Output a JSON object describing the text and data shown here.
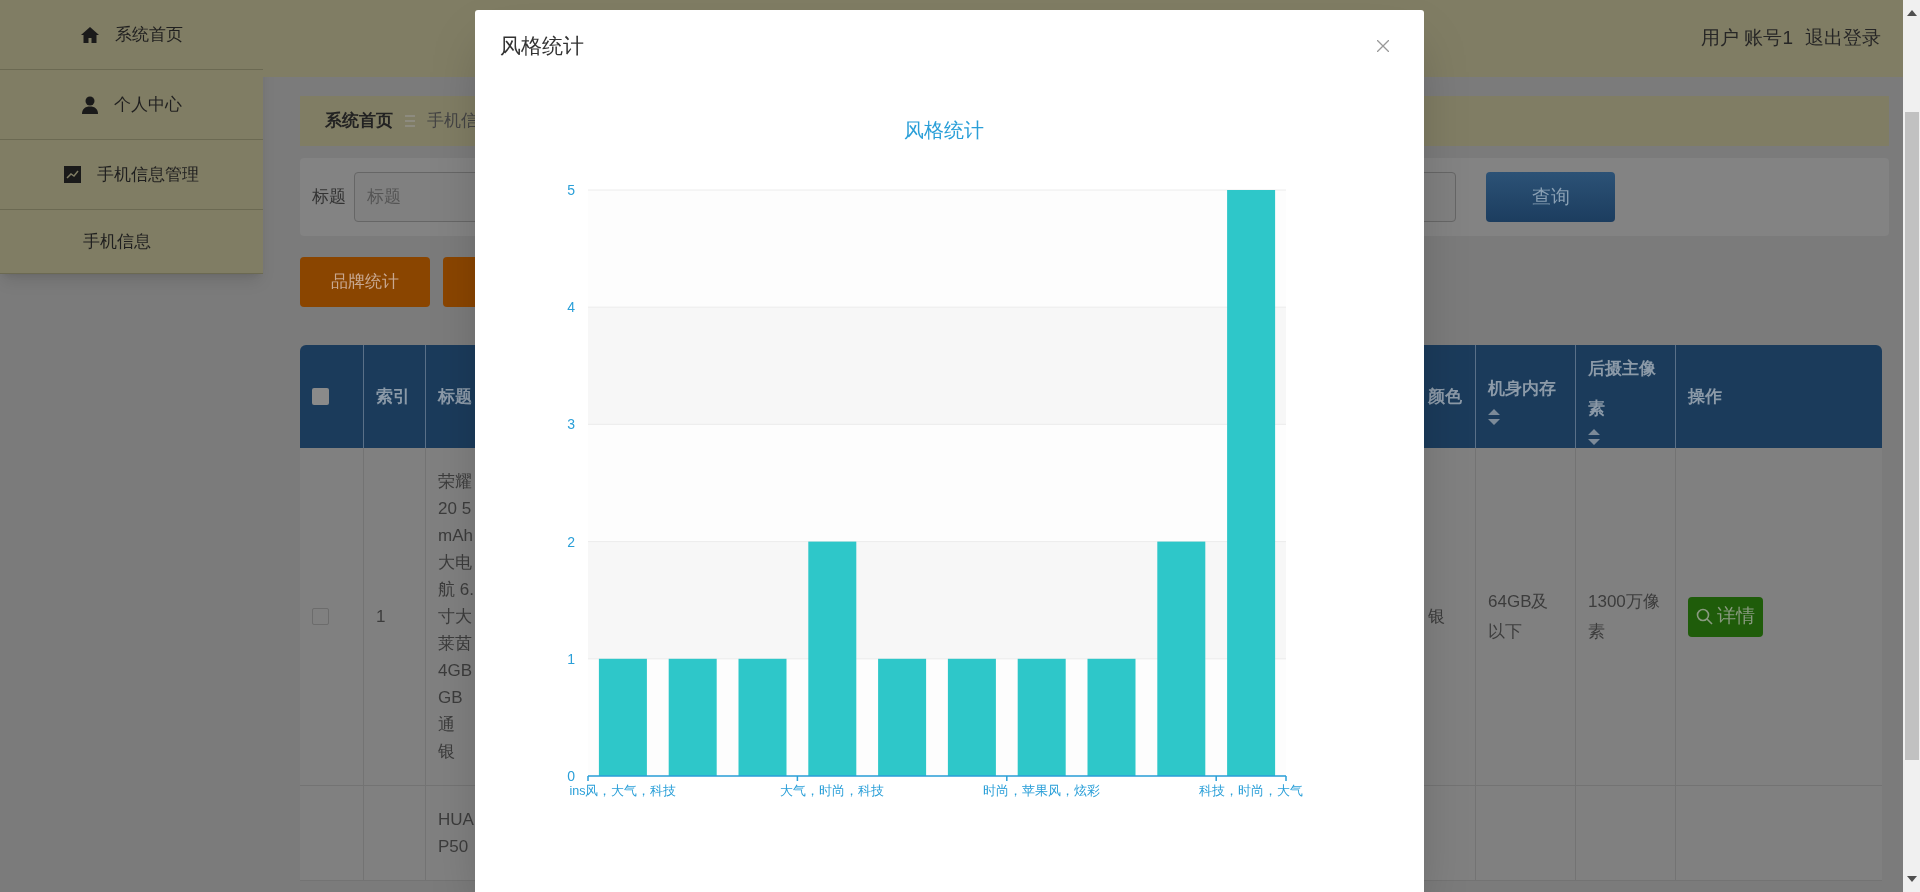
{
  "sidebar": {
    "items": [
      {
        "label": "系统首页",
        "kind": "menu"
      },
      {
        "label": "个人中心",
        "kind": "menu"
      },
      {
        "label": "手机信息管理",
        "kind": "menu"
      },
      {
        "label": "手机信息",
        "kind": "submenu"
      }
    ]
  },
  "header": {
    "user_label": "用户",
    "account": "账号1",
    "logout": "退出登录"
  },
  "breadcrumb": [
    "系统首页",
    "手机信"
  ],
  "search": {
    "label": "标题",
    "placeholder": "标题",
    "button": "查询"
  },
  "toolbar": {
    "buttons": [
      "品牌统计"
    ]
  },
  "table": {
    "columns": [
      {
        "kind": "checkbox",
        "checked": false
      },
      {
        "kind": "text",
        "label": "索引"
      },
      {
        "kind": "text",
        "label": "标题"
      },
      {
        "kind": "text",
        "label": "颜色"
      },
      {
        "kind": "sortable",
        "label": "机身内存"
      },
      {
        "kind": "sortable",
        "label": "后摄主像素"
      },
      {
        "kind": "text",
        "label": "操作"
      }
    ],
    "rows": [
      {
        "checked": false,
        "index": "1",
        "title": [
          "荣耀",
          "20 5",
          "mAh",
          "大电",
          "航 6.",
          "寸大",
          "莱茵",
          "4GB",
          "GB",
          "通",
          "银"
        ],
        "phone_color": "银",
        "memory": "64GB及以下",
        "camera": "1300万像素",
        "action": "详情"
      },
      {
        "title": [
          "HUA",
          "P50"
        ]
      }
    ]
  },
  "modal": {
    "title": "风格统计",
    "chart_data": {
      "type": "bar",
      "title": "风格统计",
      "categories": [
        "ins风，大气，科技",
        null,
        null,
        "大气，时尚，科技",
        null,
        null,
        "时尚，苹果风，炫彩",
        null,
        null,
        "科技，时尚，大气"
      ],
      "series": [
        {
          "color": "#2ec7c9",
          "values": [
            1,
            1,
            1,
            2,
            1,
            1,
            1,
            1,
            2,
            5
          ]
        }
      ],
      "grid": true,
      "ylim": [
        0,
        5
      ],
      "yticks": [
        0,
        1,
        2,
        3,
        4,
        5
      ]
    }
  }
}
